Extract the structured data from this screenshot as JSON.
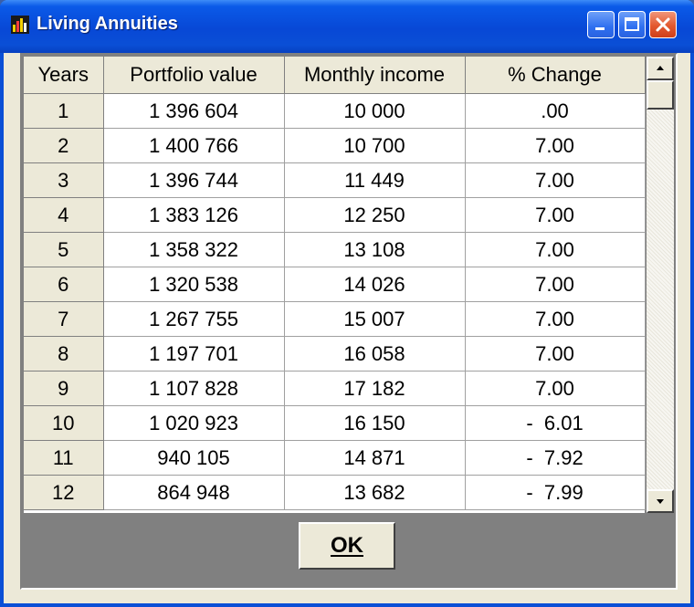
{
  "window": {
    "title": "Living Annuities",
    "app_icon": "chart-bars-icon",
    "controls": [
      "minimize-icon",
      "maximize-icon",
      "close-icon"
    ]
  },
  "table": {
    "columns": [
      "Years",
      "Portfolio value",
      "Monthly income",
      "% Change"
    ],
    "rows": [
      [
        "1",
        "1 396 604",
        "10 000",
        ".00"
      ],
      [
        "2",
        "1 400 766",
        "10 700",
        "7.00"
      ],
      [
        "3",
        "1 396 744",
        "11 449",
        "7.00"
      ],
      [
        "4",
        "1 383 126",
        "12 250",
        "7.00"
      ],
      [
        "5",
        "1 358 322",
        "13 108",
        "7.00"
      ],
      [
        "6",
        "1 320 538",
        "14 026",
        "7.00"
      ],
      [
        "7",
        "1 267 755",
        "15 007",
        "7.00"
      ],
      [
        "8",
        "1 197 701",
        "16 058",
        "7.00"
      ],
      [
        "9",
        "1 107 828",
        "17 182",
        "7.00"
      ],
      [
        "10",
        "1 020 923",
        "16 150",
        "-  6.01"
      ],
      [
        "11",
        "940 105",
        "14 871",
        "-  7.92"
      ],
      [
        "12",
        "864 948",
        "13 682",
        "-  7.99"
      ]
    ]
  },
  "buttons": {
    "ok_label": "OK"
  },
  "colors": {
    "titlebar": "#0a4fd6",
    "close_button": "#e3582f",
    "dialog_face": "#ece9d8",
    "grid_backdrop": "#808080"
  }
}
